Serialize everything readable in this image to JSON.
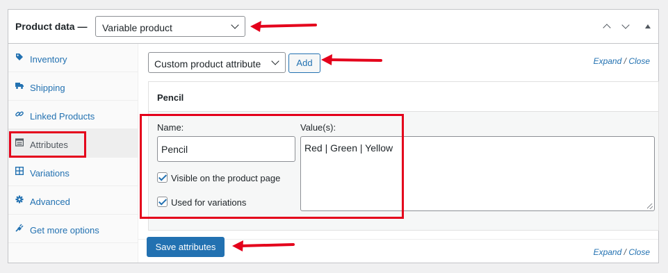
{
  "header": {
    "title": "Product data —",
    "product_type": "Variable product"
  },
  "sidebar": {
    "items": [
      {
        "label": "Inventory",
        "icon": "tag-icon"
      },
      {
        "label": "Shipping",
        "icon": "truck-icon"
      },
      {
        "label": "Linked Products",
        "icon": "link-icon"
      },
      {
        "label": "Attributes",
        "icon": "list-icon",
        "active": true
      },
      {
        "label": "Variations",
        "icon": "grid-icon"
      },
      {
        "label": "Advanced",
        "icon": "gear-icon"
      },
      {
        "label": "Get more options",
        "icon": "plugin-icon"
      }
    ]
  },
  "toolbar": {
    "attribute_select": "Custom product attribute",
    "add_label": "Add",
    "expand_label": "Expand",
    "separator": "/",
    "close_label": "Close"
  },
  "attribute": {
    "heading": "Pencil",
    "name_label": "Name:",
    "name_value": "Pencil",
    "values_label": "Value(s):",
    "values_value": "Red | Green | Yellow",
    "visible_label": "Visible on the product page",
    "visible_checked": true,
    "variations_label": "Used for variations",
    "variations_checked": true
  },
  "footer": {
    "save_label": "Save attributes",
    "expand_label": "Expand",
    "separator": "/",
    "close_label": "Close"
  },
  "colors": {
    "accent": "#2271b1",
    "annotation_red": "#e4001b"
  }
}
